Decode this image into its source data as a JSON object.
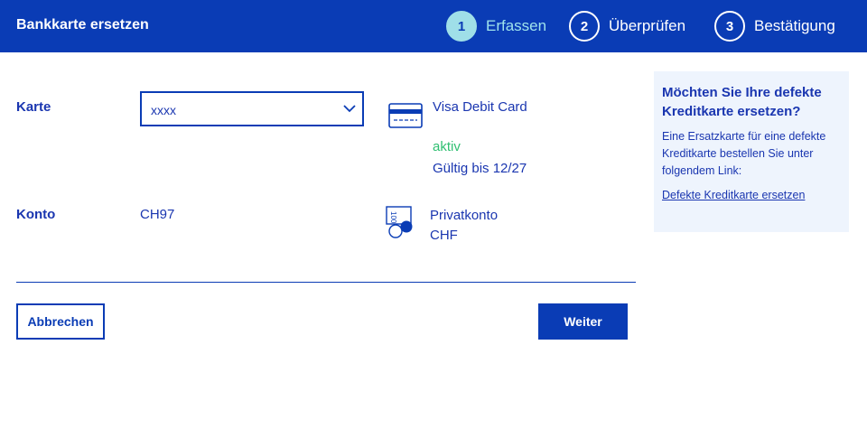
{
  "header": {
    "title": "Bankkarte ersetzen",
    "steps": [
      {
        "number": "1",
        "label": "Erfassen",
        "active": true
      },
      {
        "number": "2",
        "label": "Überprüfen",
        "active": false
      },
      {
        "number": "3",
        "label": "Bestätigung",
        "active": false
      }
    ]
  },
  "form": {
    "card_label": "Karte",
    "card_select_value": "xxxx",
    "card_type": "Visa Debit Card",
    "card_status": "aktiv",
    "card_validity": "Gültig bis 12/27",
    "account_label": "Konto",
    "account_value": "CH97",
    "account_type": "Privatkonto",
    "account_currency": "CHF"
  },
  "actions": {
    "cancel_label": "Abbrechen",
    "next_label": "Weiter"
  },
  "info": {
    "heading": "Möchten Sie Ihre defekte Kreditkarte ersetzen?",
    "body": "Eine Ersatzkarte für eine defekte Kreditkarte bestellen Sie unter folgendem Link:",
    "link": "Defekte Kreditkarte ersetzen"
  },
  "colors": {
    "brand": "#0a3cb5",
    "active_step": "#9fdfe8",
    "status_active": "#2fbf71",
    "info_background": "#eef4fd"
  },
  "icons": {
    "card": "credit-card-icon",
    "account": "banknote-coins-icon",
    "select": "chevron-down-icon"
  }
}
